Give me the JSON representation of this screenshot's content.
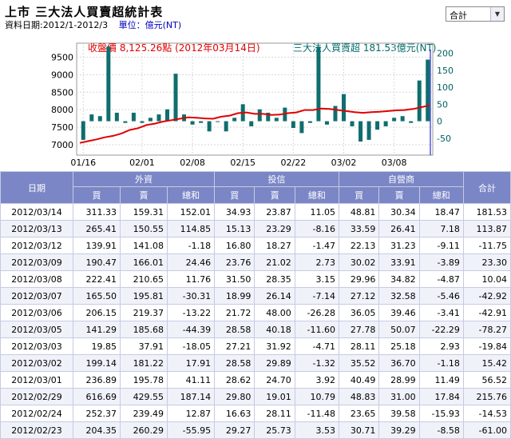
{
  "header": {
    "title": "上市 三大法人買賣超統計表",
    "date_range": "資料日期:2012/1-2012/3",
    "unit": "單位：億元(NT)"
  },
  "selector": {
    "value": "合計"
  },
  "chart_data": {
    "type": "bar+line",
    "legend_left": "收盤價 8,125.26點 (2012年03月14日)",
    "legend_right": "三大法人買賣超 181.53億元(NT)",
    "x_ticks": [
      "01/16",
      "02/01",
      "02/08",
      "02/15",
      "02/22",
      "03/02",
      "03/08"
    ],
    "y_left_ticks": [
      7000,
      7500,
      8000,
      8500,
      9000,
      9500
    ],
    "y_left_range": [
      6700,
      9900
    ],
    "y_right_ticks": [
      -50,
      0,
      50,
      100,
      150,
      200
    ],
    "y_right_range": [
      -100,
      230
    ],
    "bars": [
      -55,
      20,
      15,
      220,
      25,
      -5,
      25,
      -5,
      10,
      20,
      35,
      140,
      20,
      -10,
      -5,
      -30,
      0,
      -30,
      10,
      50,
      -15,
      35,
      25,
      10,
      40,
      -20,
      -35,
      -5,
      220,
      -10,
      45,
      80,
      -15,
      -60,
      -55,
      -25,
      -15,
      10,
      15,
      -5,
      120,
      181.53
    ],
    "close": [
      7050,
      7100,
      7150,
      7210,
      7250,
      7320,
      7420,
      7470,
      7560,
      7600,
      7660,
      7700,
      7740,
      7780,
      7770,
      7750,
      7740,
      7800,
      7830,
      7900,
      7920,
      7880,
      7880,
      7850,
      7860,
      7900,
      7920,
      7990,
      7990,
      8030,
      8020,
      7990,
      7960,
      7930,
      7910,
      7930,
      7940,
      7960,
      7980,
      7990,
      8020,
      8070,
      8125
    ]
  },
  "table": {
    "group_headers": [
      "日期",
      "外資",
      "投信",
      "自營商",
      "合計"
    ],
    "sub_headers": [
      "買",
      "賣",
      "總和",
      "買",
      "賣",
      "總和",
      "買",
      "賣",
      "總和"
    ],
    "rows": [
      [
        "2012/03/14",
        "311.33",
        "159.31",
        "152.01",
        "34.93",
        "23.87",
        "11.05",
        "48.81",
        "30.34",
        "18.47",
        "181.53"
      ],
      [
        "2012/03/13",
        "265.41",
        "150.55",
        "114.85",
        "15.13",
        "23.29",
        "-8.16",
        "33.59",
        "26.41",
        "7.18",
        "113.87"
      ],
      [
        "2012/03/12",
        "139.91",
        "141.08",
        "-1.18",
        "16.80",
        "18.27",
        "-1.47",
        "22.13",
        "31.23",
        "-9.11",
        "-11.75"
      ],
      [
        "2012/03/09",
        "190.47",
        "166.01",
        "24.46",
        "23.76",
        "21.02",
        "2.73",
        "30.02",
        "33.91",
        "-3.89",
        "23.30"
      ],
      [
        "2012/03/08",
        "222.41",
        "210.65",
        "11.76",
        "31.50",
        "28.35",
        "3.15",
        "29.96",
        "34.82",
        "-4.87",
        "10.04"
      ],
      [
        "2012/03/07",
        "165.50",
        "195.81",
        "-30.31",
        "18.99",
        "26.14",
        "-7.14",
        "27.12",
        "32.58",
        "-5.46",
        "-42.92"
      ],
      [
        "2012/03/06",
        "206.15",
        "219.37",
        "-13.22",
        "21.72",
        "48.00",
        "-26.28",
        "36.05",
        "39.46",
        "-3.41",
        "-42.91"
      ],
      [
        "2012/03/05",
        "141.29",
        "185.68",
        "-44.39",
        "28.58",
        "40.18",
        "-11.60",
        "27.78",
        "50.07",
        "-22.29",
        "-78.27"
      ],
      [
        "2012/03/03",
        "19.85",
        "37.91",
        "-18.05",
        "27.21",
        "31.92",
        "-4.71",
        "28.11",
        "25.18",
        "2.93",
        "-19.84"
      ],
      [
        "2012/03/02",
        "199.14",
        "181.22",
        "17.91",
        "28.58",
        "29.89",
        "-1.32",
        "35.52",
        "36.70",
        "-1.18",
        "15.42"
      ],
      [
        "2012/03/01",
        "236.89",
        "195.78",
        "41.11",
        "28.62",
        "24.70",
        "3.92",
        "40.49",
        "28.99",
        "11.49",
        "56.52"
      ],
      [
        "2012/02/29",
        "616.69",
        "429.55",
        "187.14",
        "29.80",
        "19.01",
        "10.79",
        "48.83",
        "31.00",
        "17.84",
        "215.76"
      ],
      [
        "2012/02/24",
        "252.37",
        "239.49",
        "12.87",
        "16.63",
        "28.11",
        "-11.48",
        "23.65",
        "39.58",
        "-15.93",
        "-14.53"
      ],
      [
        "2012/02/23",
        "204.35",
        "260.29",
        "-55.95",
        "29.27",
        "25.73",
        "3.53",
        "30.71",
        "39.29",
        "-8.58",
        "-61.00"
      ]
    ]
  }
}
